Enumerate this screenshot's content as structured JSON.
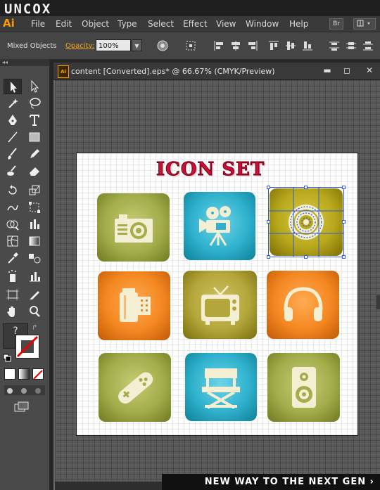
{
  "watermark": {
    "logo": "UNCOX",
    "footer": "NEW WAY TO THE NEXT GEN ›"
  },
  "app": {
    "logo": "Ai"
  },
  "menu": {
    "items": [
      "File",
      "Edit",
      "Object",
      "Type",
      "Select",
      "Effect",
      "View",
      "Window",
      "Help"
    ],
    "bridge_label": "Br"
  },
  "control_bar": {
    "selection_label": "Mixed Objects",
    "opacity_label": "Opacity:",
    "opacity_value": "100%"
  },
  "document": {
    "title": "content [Converted].eps* @ 66.67% (CMYK/Preview)",
    "minimize": "▬",
    "maximize": "◻",
    "close": "✕",
    "ai_badge": "Ai"
  },
  "artwork": {
    "heading": "ICON SET",
    "tiles": [
      {
        "name": "camera",
        "color": "olive"
      },
      {
        "name": "film-projector",
        "color": "teal"
      },
      {
        "name": "disc",
        "color": "gold",
        "selected": true
      },
      {
        "name": "film-roll",
        "color": "orange"
      },
      {
        "name": "television",
        "color": "olive"
      },
      {
        "name": "headphones",
        "color": "orange"
      },
      {
        "name": "game-controller",
        "color": "olive"
      },
      {
        "name": "director-chair",
        "color": "teal"
      },
      {
        "name": "speaker",
        "color": "olive"
      }
    ]
  },
  "tools": {
    "help_glyph": "?"
  },
  "colors": {
    "accent": "#ff9a00",
    "selection": "#2f5bd6",
    "heading": "#c8103a",
    "icon_fill": "#f4efd2"
  }
}
